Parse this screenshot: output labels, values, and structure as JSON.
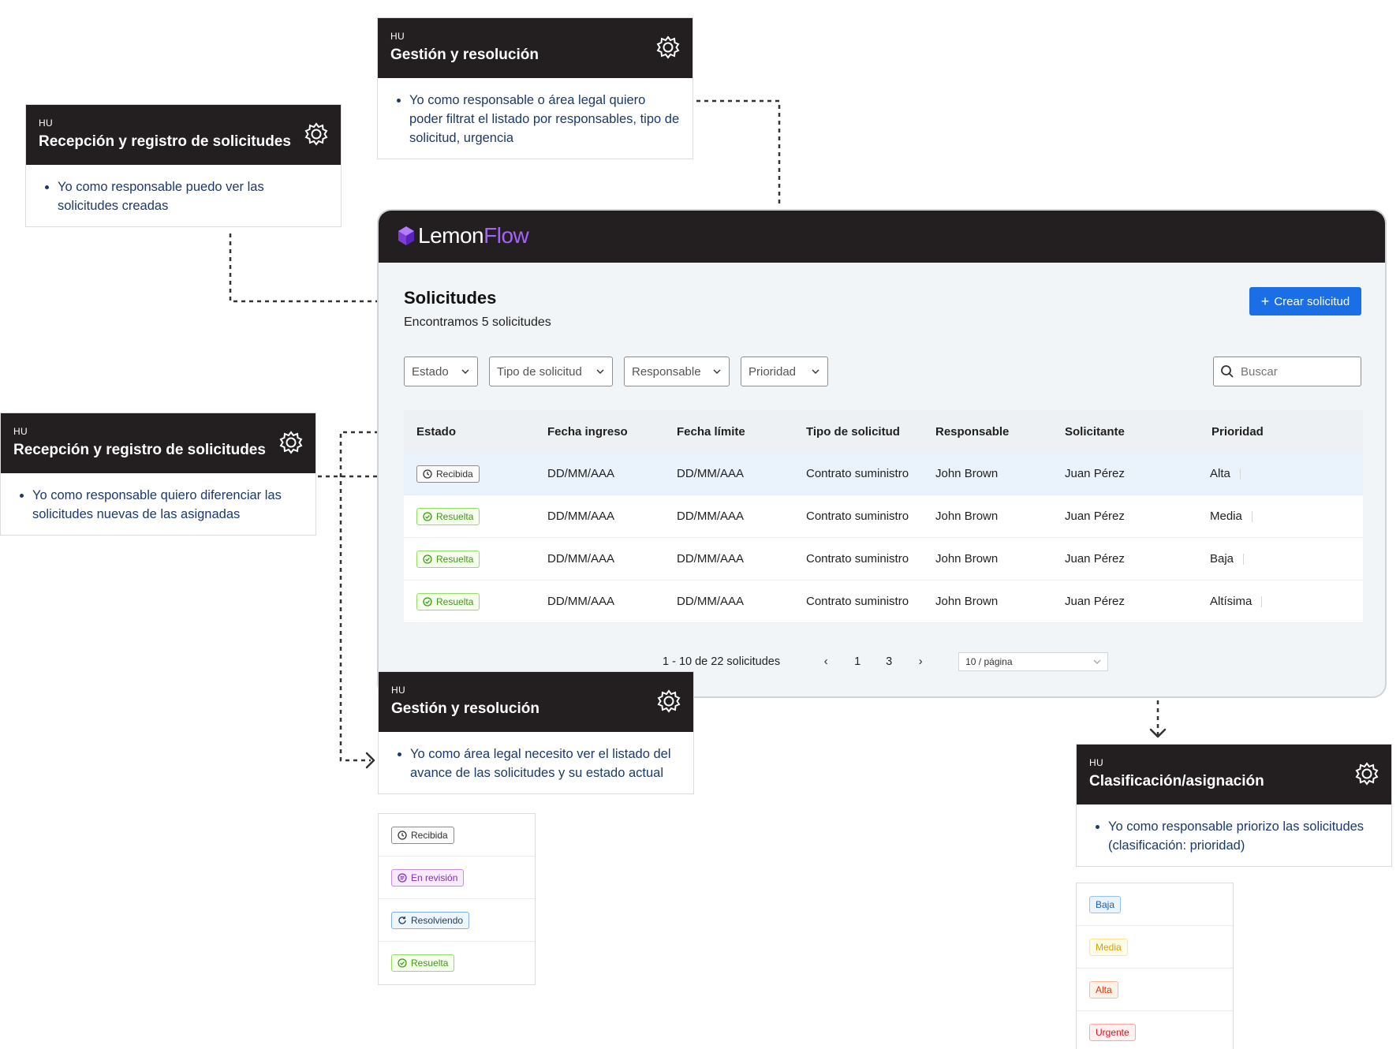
{
  "cards": [
    {
      "id": "top",
      "tag": "HU",
      "title": "Gestión y resolución",
      "items": [
        "Yo como responsable o área legal quiero poder filtrat el listado por responsables, tipo de solicitud, urgencia"
      ]
    },
    {
      "id": "left1",
      "tag": "HU",
      "title": "Recepción y registro de solicitudes",
      "items": [
        "Yo como responsable puedo ver las solicitudes creadas"
      ]
    },
    {
      "id": "left2",
      "tag": "HU",
      "title": "Recepción y registro de solicitudes",
      "items": [
        "Yo como responsable quiero diferenciar las solicitudes nuevas de las asignadas"
      ]
    },
    {
      "id": "bottom",
      "tag": "HU",
      "title": "Gestión y resolución",
      "items": [
        "Yo como área legal necesito ver el listado del avance de las solicitudes y su estado actual"
      ]
    },
    {
      "id": "right",
      "tag": "HU",
      "title": "Clasificación/asignación",
      "items": [
        "Yo como responsable priorizo las solicitudes (clasificación: prioridad)"
      ]
    }
  ],
  "app": {
    "logo_part1": "Lemon",
    "logo_part2": "Flow",
    "title": "Solicitudes",
    "subtitle": "Encontramos 5 solicitudes",
    "create_button": "Crear solicitud",
    "filters": [
      "Estado",
      "Tipo de solicitud",
      "Responsable",
      "Prioridad"
    ],
    "search_placeholder": "Buscar",
    "columns": [
      "Estado",
      "Fecha ingreso",
      "Fecha límite",
      "Tipo de solicitud",
      "Responsable",
      "Solicitante",
      "Prioridad"
    ],
    "rows": [
      {
        "status": "Recibida",
        "status_kind": "recibida",
        "fecha_ingreso": "DD/MM/AAA",
        "fecha_limite": "DD/MM/AAA",
        "tipo": "Contrato suministro",
        "responsable": "John Brown",
        "solicitante": "Juan Pérez",
        "prioridad": "Alta",
        "selected": true
      },
      {
        "status": "Resuelta",
        "status_kind": "resuelta",
        "fecha_ingreso": "DD/MM/AAA",
        "fecha_limite": "DD/MM/AAA",
        "tipo": "Contrato suministro",
        "responsable": "John Brown",
        "solicitante": "Juan Pérez",
        "prioridad": "Media",
        "selected": false
      },
      {
        "status": "Resuelta",
        "status_kind": "resuelta",
        "fecha_ingreso": "DD/MM/AAA",
        "fecha_limite": "DD/MM/AAA",
        "tipo": "Contrato suministro",
        "responsable": "John Brown",
        "solicitante": "Juan Pérez",
        "prioridad": "Baja",
        "selected": false
      },
      {
        "status": "Resuelta",
        "status_kind": "resuelta",
        "fecha_ingreso": "DD/MM/AAA",
        "fecha_limite": "DD/MM/AAA",
        "tipo": "Contrato suministro",
        "responsable": "John Brown",
        "solicitante": "Juan Pérez",
        "prioridad": "Altísima",
        "selected": false
      }
    ],
    "pagination": {
      "info": "1 - 10 de 22 solicitudes",
      "pages": [
        "1",
        "3"
      ],
      "page_size": "10 / página"
    }
  },
  "status_legend": [
    {
      "label": "Recibida",
      "kind": "recibida"
    },
    {
      "label": "En revisión",
      "kind": "revision"
    },
    {
      "label": "Resolviendo",
      "kind": "resolviendo"
    },
    {
      "label": "Resuelta",
      "kind": "resuelta"
    }
  ],
  "priority_legend": [
    {
      "label": "Baja",
      "kind": "baja"
    },
    {
      "label": "Media",
      "kind": "media"
    },
    {
      "label": "Alta",
      "kind": "alta"
    },
    {
      "label": "Urgente",
      "kind": "urgente"
    }
  ],
  "colors": {
    "header_dark": "#231f20",
    "brand_purple": "#a761ff",
    "primary_blue": "#1a6fe6",
    "recibida": {
      "fg": "#333333",
      "bg": "#fafafa",
      "border": "#8c8c8c"
    },
    "revision": {
      "fg": "#8a2bb3",
      "bg": "#f7ecfc",
      "border": "#c98be3"
    },
    "resolviendo": {
      "fg": "#1f3b5c",
      "bg": "#eef5fd",
      "border": "#7fb1e8"
    },
    "resuelta": {
      "fg": "#389e0d",
      "bg": "#f6ffed",
      "border": "#95de64"
    },
    "baja": {
      "fg": "#1d5fb8",
      "bg": "#eaf3fe",
      "border": "#91c3f5"
    },
    "media": {
      "fg": "#d4a100",
      "bg": "#fffbe6",
      "border": "#ffe58f"
    },
    "alta": {
      "fg": "#d4380d",
      "bg": "#fff2e8",
      "border": "#ffbb96"
    },
    "urgente": {
      "fg": "#cf1322",
      "bg": "#fff1f0",
      "border": "#ffa39e"
    }
  }
}
